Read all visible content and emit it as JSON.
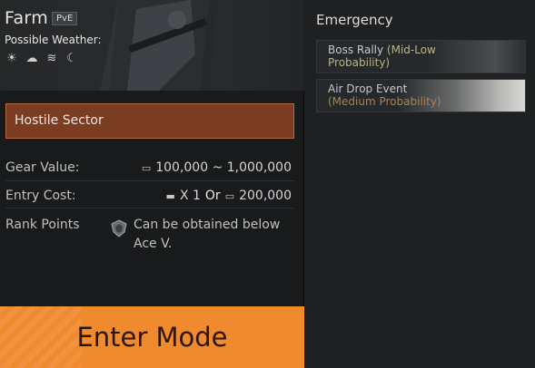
{
  "mode": {
    "title": "Farm",
    "tag": "PvE",
    "weather_label": "Possible Weather:",
    "weather_icons": [
      {
        "name": "sun-icon",
        "glyph": "☀"
      },
      {
        "name": "rain-cloud-icon",
        "glyph": "☁"
      },
      {
        "name": "fog-icon",
        "glyph": "≋"
      },
      {
        "name": "moon-icon",
        "glyph": "☾"
      }
    ]
  },
  "sector": {
    "label": "Hostile Sector"
  },
  "stats": {
    "gear_value_label": "Gear Value:",
    "gear_value": "100,000 ~ 1,000,000",
    "entry_cost_label": "Entry Cost:",
    "entry_cost_ticket": "X 1",
    "entry_cost_or": "Or",
    "entry_cost_money": "200,000",
    "rank_points_label": "Rank Points",
    "rank_points_desc": "Can be obtained below Ace V."
  },
  "enter_button": {
    "label": "Enter Mode"
  },
  "emergency": {
    "title": "Emergency",
    "events": [
      {
        "name": "Boss Rally",
        "probability": "(Mid-Low Probability)"
      },
      {
        "name": "Air Drop Event",
        "probability": "(Medium Probability)"
      }
    ]
  },
  "colors": {
    "accent_orange": "#f08a2e",
    "sector_fill": "#7a3d22",
    "sector_border": "#b5673f"
  }
}
